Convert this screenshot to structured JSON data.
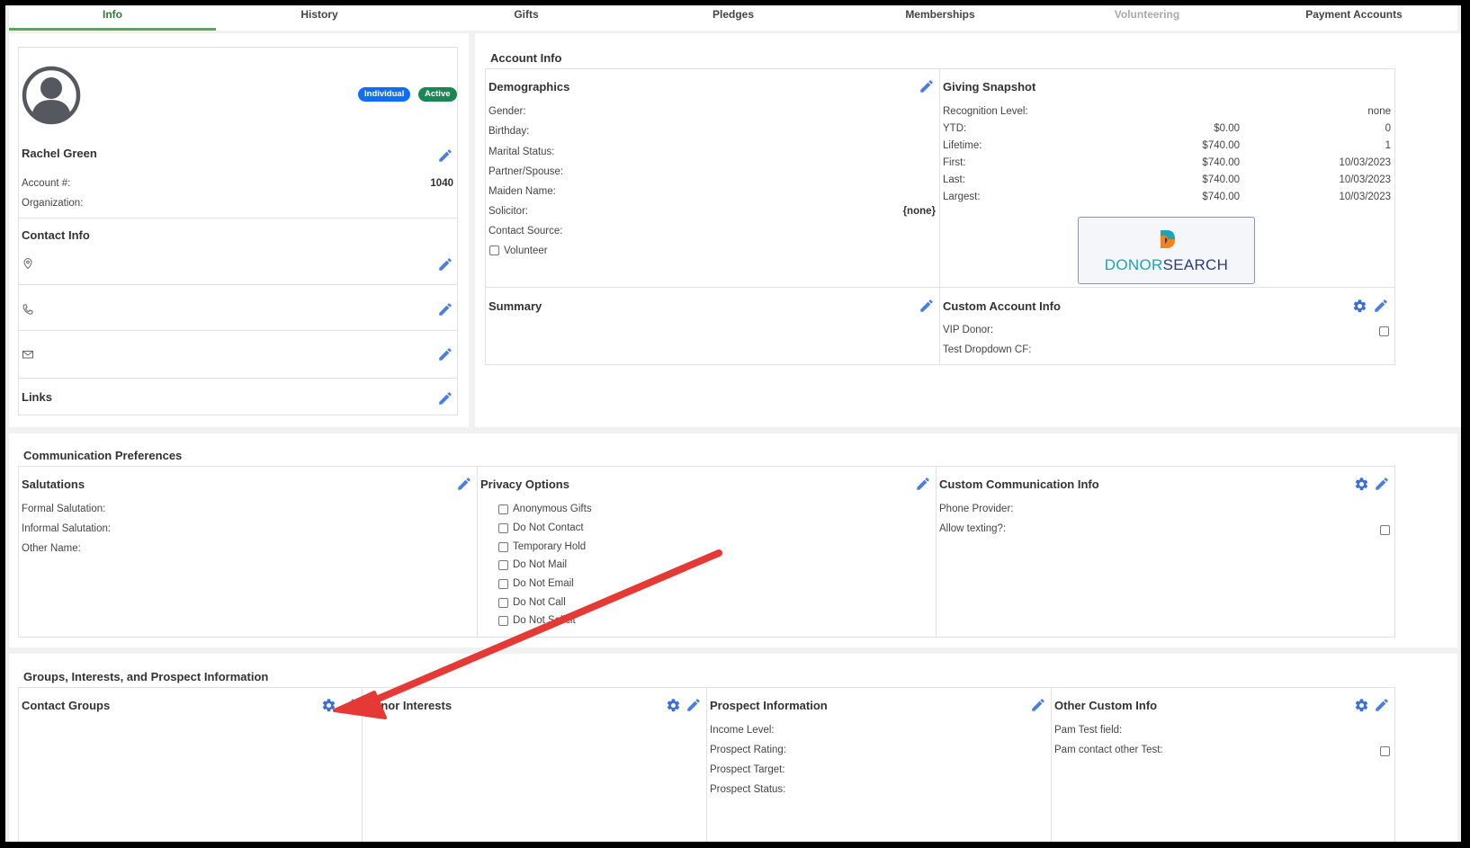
{
  "tabs": [
    {
      "label": "Info",
      "state": "active"
    },
    {
      "label": "History",
      "state": "normal"
    },
    {
      "label": "Gifts",
      "state": "normal"
    },
    {
      "label": "Pledges",
      "state": "normal"
    },
    {
      "label": "Memberships",
      "state": "normal"
    },
    {
      "label": "Volunteering",
      "state": "disabled"
    },
    {
      "label": "Payment Accounts",
      "state": "normal"
    }
  ],
  "profile": {
    "name": "Rachel Green",
    "badge_type": "Individual",
    "badge_status": "Active",
    "account_label": "Account #:",
    "account_value": "1040",
    "organization_label": "Organization:"
  },
  "contact_info": {
    "title": "Contact Info",
    "icons": [
      "location-pin-icon",
      "phone-icon",
      "envelope-icon"
    ]
  },
  "links": {
    "title": "Links"
  },
  "account_info": {
    "title": "Account Info",
    "demographics": {
      "title": "Demographics",
      "fields": [
        "Gender:",
        "Birthday:",
        "Marital Status:",
        "Partner/Spouse:",
        "Maiden Name:",
        "Solicitor:",
        "Contact Source:"
      ],
      "solicitor_value": "{none}",
      "volunteer_label": "Volunteer"
    },
    "giving_snapshot": {
      "title": "Giving Snapshot",
      "recognition_label": "Recognition Level:",
      "recognition_value": "none",
      "rows": [
        {
          "label": "YTD:",
          "amount": "$0.00",
          "extra": "0"
        },
        {
          "label": "Lifetime:",
          "amount": "$740.00",
          "extra": "1"
        },
        {
          "label": "First:",
          "amount": "$740.00",
          "extra": "10/03/2023"
        },
        {
          "label": "Last:",
          "amount": "$740.00",
          "extra": "10/03/2023"
        },
        {
          "label": "Largest:",
          "amount": "$740.00",
          "extra": "10/03/2023"
        }
      ],
      "donorsearch_a": "DONOR",
      "donorsearch_b": "SEARCH"
    },
    "summary": {
      "title": "Summary"
    },
    "custom_account": {
      "title": "Custom Account Info",
      "fields": [
        "VIP Donor:",
        "Test Dropdown CF:"
      ]
    }
  },
  "communication": {
    "title": "Communication Preferences",
    "salutations": {
      "title": "Salutations",
      "fields": [
        "Formal Salutation:",
        "Informal Salutation:",
        "Other Name:"
      ]
    },
    "privacy": {
      "title": "Privacy Options",
      "options": [
        "Anonymous Gifts",
        "Do Not Contact",
        "Temporary Hold",
        "Do Not Mail",
        "Do Not Email",
        "Do Not Call",
        "Do Not Solicit"
      ]
    },
    "custom": {
      "title": "Custom Communication Info",
      "fields": [
        "Phone Provider:",
        "Allow texting?:"
      ]
    }
  },
  "groups": {
    "title": "Groups, Interests, and Prospect Information",
    "contact_groups": "Contact Groups",
    "donor_interests": "Donor Interests",
    "prospect": {
      "title": "Prospect Information",
      "fields": [
        "Income Level:",
        "Prospect Rating:",
        "Prospect Target:",
        "Prospect Status:"
      ]
    },
    "other": {
      "title": "Other Custom Info",
      "fields": [
        "Pam Test field:",
        "Pam contact other Test:"
      ]
    }
  },
  "colors": {
    "accent": "#3b82f6",
    "active_tab": "#4caf50",
    "badge_individual": "#0d6efd",
    "badge_active": "#198754",
    "annotation_arrow": "#e53935",
    "icon_blue": "#3b6fd8"
  }
}
